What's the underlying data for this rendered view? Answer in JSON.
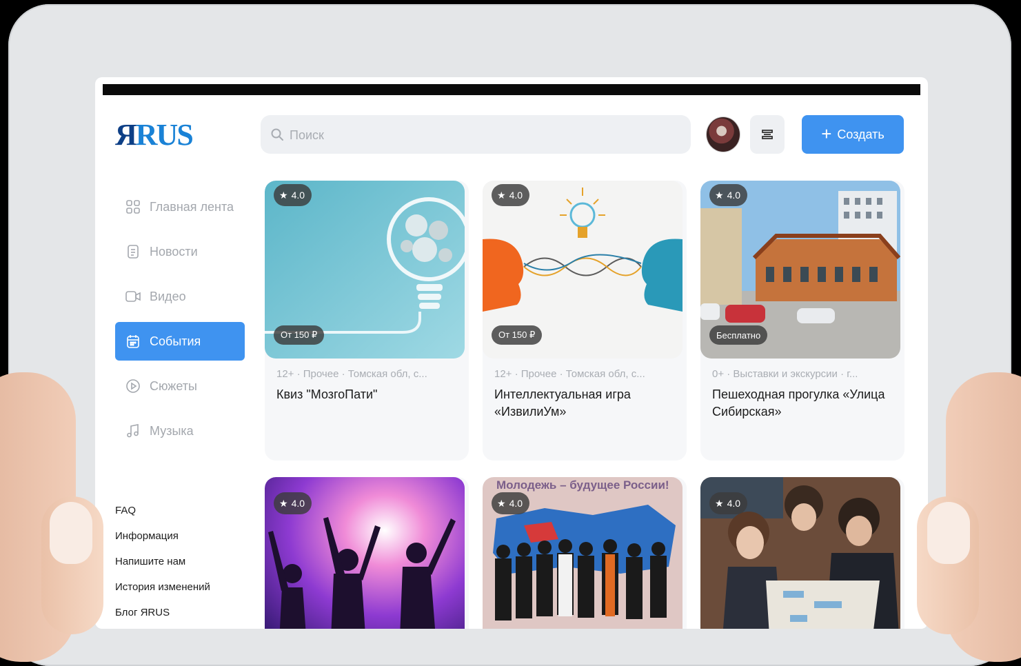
{
  "app": {
    "logo_part1": "Я",
    "logo_part2": "RUS"
  },
  "header": {
    "search_placeholder": "Поиск",
    "create_label": "Создать"
  },
  "sidebar": {
    "items": [
      {
        "label": "Главная лента",
        "icon": "grid-icon",
        "active": false
      },
      {
        "label": "Новости",
        "icon": "news-icon",
        "active": false
      },
      {
        "label": "Видео",
        "icon": "video-icon",
        "active": false
      },
      {
        "label": "События",
        "icon": "calendar-icon",
        "active": true
      },
      {
        "label": "Сюжеты",
        "icon": "play-circle-icon",
        "active": false
      },
      {
        "label": "Музыка",
        "icon": "music-note-icon",
        "active": false
      }
    ],
    "links": [
      "FAQ",
      "Информация",
      "Напишите нам",
      "История изменений",
      "Блог ЯRUS"
    ]
  },
  "cards": [
    {
      "rating": "4.0",
      "price": "От 150 ₽",
      "meta": "12+ · Прочее · Томская обл, с...",
      "title": "Квиз \"МозгоПати\""
    },
    {
      "rating": "4.0",
      "price": "От 150 ₽",
      "meta": "12+ · Прочее · Томская обл, с...",
      "title": "Интеллектуальная игра «ИзвилиУм»"
    },
    {
      "rating": "4.0",
      "price": "Бесплатно",
      "meta": "0+ · Выставки и экскурсии · г...",
      "title": "Пешеходная прогулка «Улица Сибирская»"
    },
    {
      "rating": "4.0"
    },
    {
      "rating": "4.0",
      "banner": "Молодежь – будущее России!"
    },
    {
      "rating": "4.0"
    }
  ],
  "colors": {
    "accent": "#3f93f0",
    "logo_dark": "#0d3f86",
    "logo_light": "#1a82d6"
  }
}
